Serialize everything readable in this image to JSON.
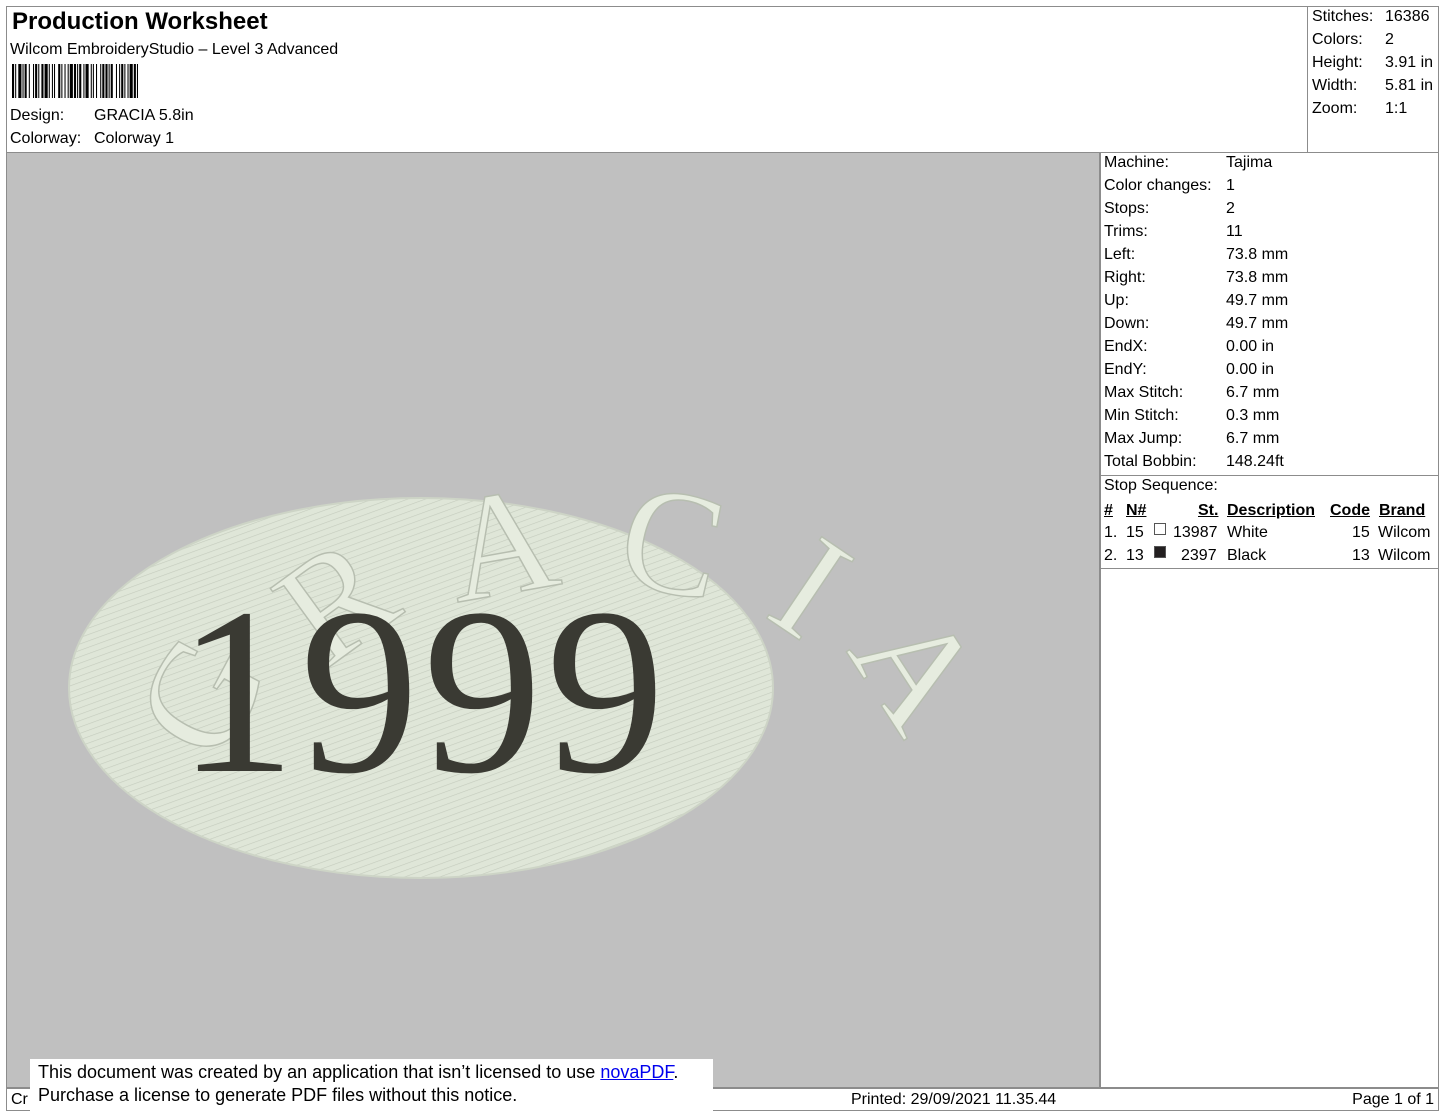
{
  "header": {
    "title": "Production Worksheet",
    "software": "Wilcom EmbroideryStudio – Level 3 Advanced",
    "design_label": "Design:",
    "design_value": "GRACIA 5.8in",
    "colorway_label": "Colorway:",
    "colorway_value": "Colorway 1"
  },
  "stats": [
    {
      "label": "Stitches:",
      "value": "16386"
    },
    {
      "label": "Colors:",
      "value": "2"
    },
    {
      "label": "Height:",
      "value": "3.91 in"
    },
    {
      "label": "Width:",
      "value": "5.81 in"
    },
    {
      "label": "Zoom:",
      "value": "1:1"
    }
  ],
  "design_preview": {
    "arc_letters": [
      "G",
      "R",
      "A",
      "C",
      "I",
      "A"
    ],
    "year": "1999",
    "thread_colors": {
      "white": "#e6ecdf",
      "oval": "#dfe6d8",
      "black": "#3a3a33",
      "background": "#c0c0c0"
    }
  },
  "machine_info": [
    {
      "label": "Machine:",
      "value": "Tajima"
    },
    {
      "label": "Color changes:",
      "value": "1"
    },
    {
      "label": "Stops:",
      "value": "2"
    },
    {
      "label": "Trims:",
      "value": "11"
    },
    {
      "label": "Left:",
      "value": "73.8 mm"
    },
    {
      "label": "Right:",
      "value": "73.8 mm"
    },
    {
      "label": "Up:",
      "value": "49.7 mm"
    },
    {
      "label": "Down:",
      "value": "49.7 mm"
    },
    {
      "label": "EndX:",
      "value": "0.00 in"
    },
    {
      "label": "EndY:",
      "value": "0.00 in"
    },
    {
      "label": "Max Stitch:",
      "value": "6.7 mm"
    },
    {
      "label": "Min Stitch:",
      "value": "0.3 mm"
    },
    {
      "label": "Max Jump:",
      "value": "6.7 mm"
    },
    {
      "label": "Total Bobbin:",
      "value": "148.24ft"
    }
  ],
  "stop_sequence": {
    "title": "Stop Sequence:",
    "columns": {
      "num": "#",
      "n": "N#",
      "st": "St.",
      "description": "Description",
      "code": "Code",
      "brand": "Brand"
    },
    "rows": [
      {
        "num": "1.",
        "n": "15",
        "color": "#ffffff",
        "st": "13987",
        "description": "White",
        "code": "15",
        "brand": "Wilcom"
      },
      {
        "num": "2.",
        "n": "13",
        "color": "#231f20",
        "st": "2397",
        "description": "Black",
        "code": "13",
        "brand": "Wilcom"
      }
    ]
  },
  "footer": {
    "left_stub": "Cr",
    "printed": "Printed: 29/09/2021 11.35.44",
    "page": "Page 1 of 1"
  },
  "notice": {
    "line1_prefix": "This document was created by an application that isn’t licensed to use ",
    "link": "novaPDF",
    "line1_suffix": ".",
    "line2": "Purchase a license to generate PDF files without this notice."
  }
}
